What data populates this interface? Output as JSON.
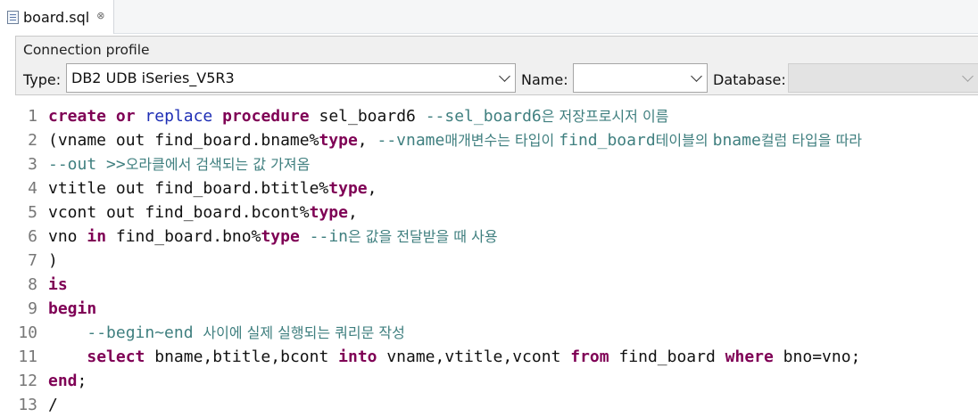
{
  "editor_tab": {
    "title": "board.sql",
    "close_glyph": "⊗"
  },
  "connection_profile": {
    "group_title": "Connection profile",
    "type_label": "Type:",
    "type_value": "DB2 UDB iSeries_V5R3",
    "name_label": "Name:",
    "name_value": "",
    "database_label": "Database:",
    "database_value": ""
  },
  "code_lines": [
    {
      "num": "1",
      "segments": [
        {
          "t": "create",
          "s": "k1"
        },
        {
          "t": " ",
          "s": "p"
        },
        {
          "t": "or",
          "s": "k1"
        },
        {
          "t": " ",
          "s": "p"
        },
        {
          "t": "replace",
          "s": "k2"
        },
        {
          "t": " ",
          "s": "p"
        },
        {
          "t": "procedure",
          "s": "k1"
        },
        {
          "t": " sel_board6 ",
          "s": "p"
        },
        {
          "t": "--sel_board6",
          "s": "c"
        },
        {
          "t": "은 저장프로시저 이름",
          "s": "ck"
        }
      ]
    },
    {
      "num": "2",
      "segments": [
        {
          "t": "(vname out find_board.bname%",
          "s": "p"
        },
        {
          "t": "type",
          "s": "k1"
        },
        {
          "t": ", ",
          "s": "p"
        },
        {
          "t": "--vname",
          "s": "c"
        },
        {
          "t": "매개변수는 타입이 ",
          "s": "ck"
        },
        {
          "t": "find_board",
          "s": "c"
        },
        {
          "t": "테이블의 ",
          "s": "ck"
        },
        {
          "t": "bname",
          "s": "c"
        },
        {
          "t": "컬럼 타입을 따라",
          "s": "ck"
        }
      ]
    },
    {
      "num": "3",
      "segments": [
        {
          "t": "--out >>",
          "s": "c"
        },
        {
          "t": "오라클에서 검색되는 값 가져옴",
          "s": "ck"
        }
      ]
    },
    {
      "num": "4",
      "segments": [
        {
          "t": "vtitle out find_board.btitle%",
          "s": "p"
        },
        {
          "t": "type",
          "s": "k1"
        },
        {
          "t": ",",
          "s": "p"
        }
      ]
    },
    {
      "num": "5",
      "segments": [
        {
          "t": "vcont out find_board.bcont%",
          "s": "p"
        },
        {
          "t": "type",
          "s": "k1"
        },
        {
          "t": ",",
          "s": "p"
        }
      ]
    },
    {
      "num": "6",
      "segments": [
        {
          "t": "vno ",
          "s": "p"
        },
        {
          "t": "in",
          "s": "k1"
        },
        {
          "t": " find_board.bno%",
          "s": "p"
        },
        {
          "t": "type",
          "s": "k1"
        },
        {
          "t": " ",
          "s": "p"
        },
        {
          "t": "--in",
          "s": "c"
        },
        {
          "t": "은 값을 전달받을 때 사용",
          "s": "ck"
        }
      ]
    },
    {
      "num": "7",
      "segments": [
        {
          "t": ")",
          "s": "p"
        }
      ]
    },
    {
      "num": "8",
      "segments": [
        {
          "t": "is",
          "s": "k1"
        }
      ]
    },
    {
      "num": "9",
      "segments": [
        {
          "t": "begin",
          "s": "k1"
        }
      ]
    },
    {
      "num": "10",
      "segments": [
        {
          "t": "    ",
          "s": "p"
        },
        {
          "t": "--begin~end ",
          "s": "c"
        },
        {
          "t": "사이에 실제 실행되는 쿼리문 작성",
          "s": "ck"
        }
      ]
    },
    {
      "num": "11",
      "segments": [
        {
          "t": "    ",
          "s": "p"
        },
        {
          "t": "select",
          "s": "k1"
        },
        {
          "t": " bname,btitle,bcont ",
          "s": "p"
        },
        {
          "t": "into",
          "s": "k1"
        },
        {
          "t": " vname,vtitle,vcont ",
          "s": "p"
        },
        {
          "t": "from",
          "s": "k1"
        },
        {
          "t": " find_board ",
          "s": "p"
        },
        {
          "t": "where",
          "s": "k1"
        },
        {
          "t": " bno=vno;",
          "s": "p"
        }
      ]
    },
    {
      "num": "12",
      "segments": [
        {
          "t": "end",
          "s": "k1"
        },
        {
          "t": ";",
          "s": "p"
        }
      ]
    },
    {
      "num": "13",
      "segments": [
        {
          "t": "/",
          "s": "p"
        }
      ]
    }
  ],
  "colors": {
    "keyword": "#7f0055",
    "keyword_blue": "#1e2eb5",
    "comment": "#3f7f7f",
    "line_number": "#777777"
  }
}
